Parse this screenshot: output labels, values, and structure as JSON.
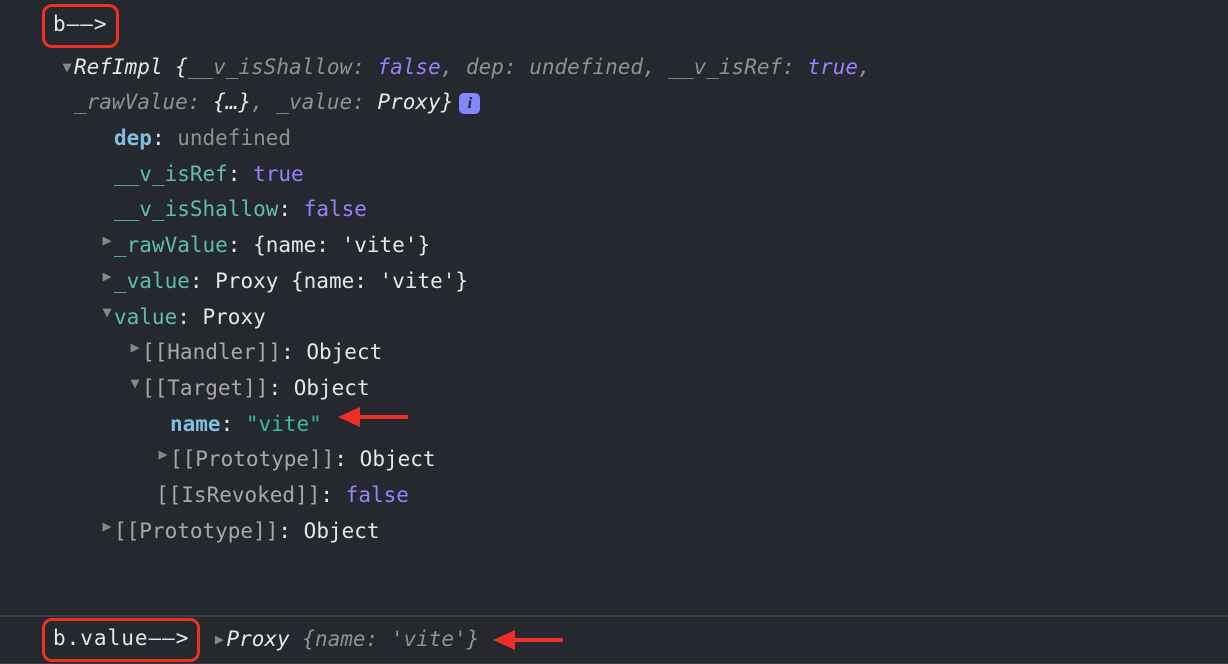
{
  "header_annotation": "b——>",
  "summary": {
    "class": "RefImpl",
    "open": "{",
    "p1k": "__v_isShallow",
    "p1v": "false",
    "p2k": "dep",
    "p2v": "undefined",
    "p3k": "__v_isRef",
    "p3v": "true",
    "sep": ", ",
    "colon": ": ",
    "p4k": "_rawValue",
    "p4v": "{…}",
    "p5k": "_value",
    "p5v": "Proxy",
    "close": "}"
  },
  "info_i": "i",
  "props": {
    "dep": {
      "k": "dep",
      "c": ": ",
      "v": "undefined"
    },
    "isRef": {
      "k": "__v_isRef",
      "c": ": ",
      "v": "true"
    },
    "isShallow": {
      "k": "__v_isShallow",
      "c": ": ",
      "v": "false"
    }
  },
  "rawValue": {
    "k": "_rawValue",
    "c": ": ",
    "v": "{name: 'vite'}"
  },
  "value": {
    "k": "_value",
    "c": ": ",
    "v": "Proxy {name: 'vite'}"
  },
  "valueProp": {
    "k": "value",
    "c": ": ",
    "v": "Proxy"
  },
  "handler": {
    "k": "[[Handler]]",
    "c": ": ",
    "v": "Object"
  },
  "target": {
    "k": "[[Target]]",
    "c": ": ",
    "v": "Object"
  },
  "target_name": {
    "k": "name",
    "c": ": ",
    "v": "\"vite\""
  },
  "proto_inner": {
    "k": "[[Prototype]]",
    "c": ": ",
    "v": "Object"
  },
  "revoked": {
    "k": "[[IsRevoked]]",
    "c": ": ",
    "v": "false"
  },
  "proto_outer": {
    "k": "[[Prototype]]",
    "c": ": ",
    "v": "Object"
  },
  "bottom": {
    "annotation": "b.value——>",
    "proxy": "Proxy",
    "obj": "{name: 'vite'}"
  }
}
